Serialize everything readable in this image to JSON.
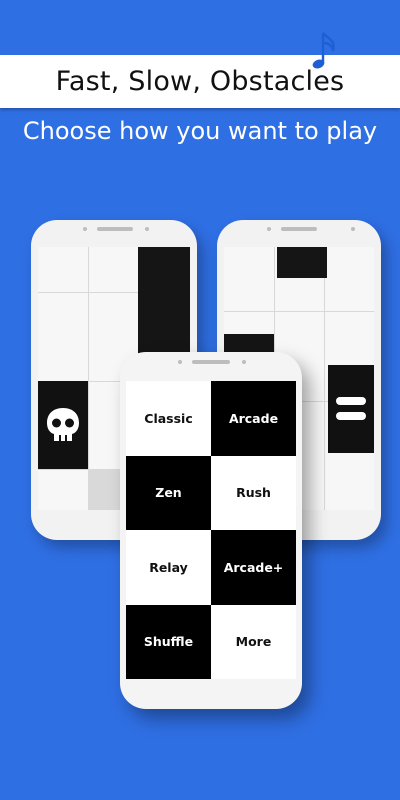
{
  "banner": {
    "title": "Fast, Slow, Obstacles"
  },
  "subtitle": "Choose how you want to play",
  "icons": {
    "note": "music-note-icon",
    "skull": "skull-icon",
    "pause": "pause-icon"
  },
  "colors": {
    "background": "#2f6fe4",
    "note": "#1f5fd6"
  },
  "menu": {
    "items": [
      {
        "label": "Classic",
        "tone": "white"
      },
      {
        "label": "Arcade",
        "tone": "black"
      },
      {
        "label": "Zen",
        "tone": "black"
      },
      {
        "label": "Rush",
        "tone": "white"
      },
      {
        "label": "Relay",
        "tone": "white"
      },
      {
        "label": "Arcade+",
        "tone": "black"
      },
      {
        "label": "Shuffle",
        "tone": "black"
      },
      {
        "label": "More",
        "tone": "white"
      }
    ]
  }
}
